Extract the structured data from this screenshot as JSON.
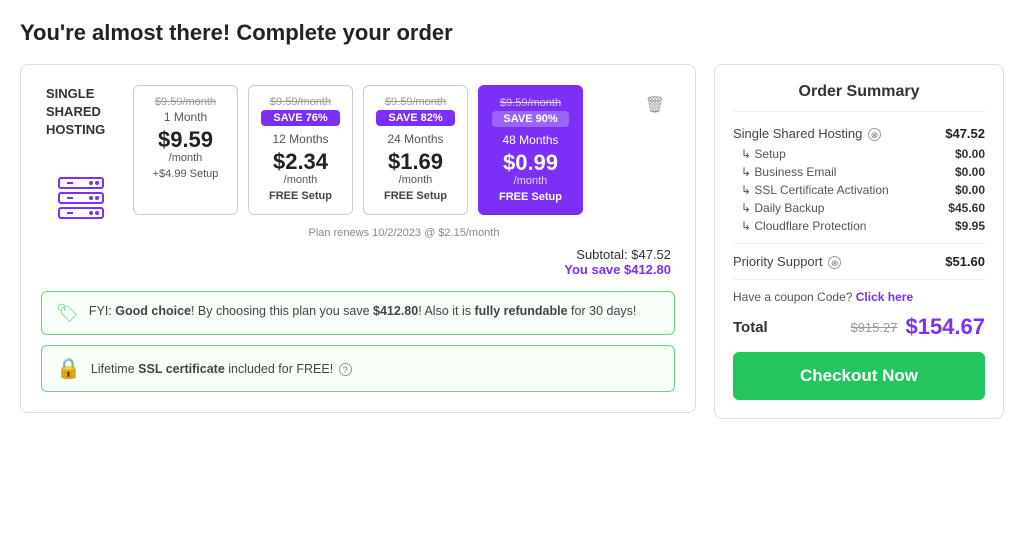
{
  "page": {
    "title": "You're almost there! Complete your order"
  },
  "plan": {
    "name": "SINGLE\nSHARED\nHOSTING",
    "renews_note": "Plan renews 10/2/2023 @ $2.15/month",
    "subtotal_label": "Subtotal:",
    "subtotal_value": "$47.52",
    "savings_label": "You save $412.80"
  },
  "plan_options": [
    {
      "id": "1month",
      "original_price": "$9.59/month",
      "save_badge": null,
      "duration": "1 Month",
      "price": "$9.59",
      "per_month": "/month",
      "setup": "+$4.99 Setup",
      "selected": false
    },
    {
      "id": "12months",
      "original_price": "$9.59/month",
      "save_badge": "SAVE 76%",
      "duration": "12 Months",
      "price": "$2.34",
      "per_month": "/month",
      "setup": "FREE Setup",
      "selected": false
    },
    {
      "id": "24months",
      "original_price": "$9.59/month",
      "save_badge": "SAVE 82%",
      "duration": "24 Months",
      "price": "$1.69",
      "per_month": "/month",
      "setup": "FREE Setup",
      "selected": false
    },
    {
      "id": "48months",
      "original_price": "$9.59/month",
      "save_badge": "SAVE 90%",
      "duration": "48 Months",
      "price": "$0.99",
      "per_month": "/month",
      "setup": "FREE Setup",
      "selected": true
    }
  ],
  "fyi": {
    "text_before": "FYI: ",
    "bold1": "Good choice",
    "text_mid": "! By choosing this plan you save ",
    "bold2": "$412.80",
    "text_mid2": "! Also it is ",
    "bold3": "fully refundable",
    "text_end": " for 30 days!"
  },
  "ssl": {
    "text": "Lifetime SSL certificate included for FREE!"
  },
  "order_summary": {
    "title": "Order Summary",
    "main_item": "Single Shared Hosting",
    "main_price": "$47.52",
    "sub_items": [
      {
        "label": "↳ Setup",
        "price": "$0.00"
      },
      {
        "label": "↳ Business Email",
        "price": "$0.00"
      },
      {
        "label": "↳ SSL Certificate Activation",
        "price": "$0.00"
      },
      {
        "label": "↳ Daily Backup",
        "price": "$45.60"
      },
      {
        "label": "↳ Cloudflare Protection",
        "price": "$9.95"
      }
    ],
    "priority_support": "Priority Support",
    "priority_price": "$51.60",
    "coupon_text": "Have a coupon Code?",
    "coupon_link": "Click here",
    "total_label": "Total",
    "original_total": "$915.27",
    "final_total": "$154.67",
    "checkout_label": "Checkout Now"
  }
}
